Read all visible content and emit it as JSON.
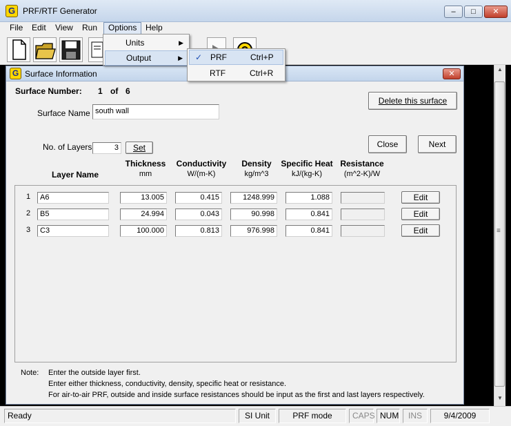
{
  "window": {
    "app_icon": "G",
    "title": "PRF/RTF Generator",
    "minimize_icon": "–",
    "maximize_icon": "□",
    "close_icon": "✕"
  },
  "menu": {
    "items": [
      "File",
      "Edit",
      "View",
      "Run",
      "Options",
      "Help"
    ]
  },
  "options_menu": {
    "units": "Units",
    "output": "Output",
    "arrow": "▶"
  },
  "output_menu": {
    "check": "✓",
    "prf_label": "PRF",
    "prf_shortcut": "Ctrl+P",
    "rtf_label": "RTF",
    "rtf_shortcut": "Ctrl+R"
  },
  "toolbar": {
    "buttons": [
      "new-file-icon",
      "open-folder-icon",
      "save-disk-icon",
      "document-icon",
      "run-icon",
      "play-icon",
      "help-icon"
    ]
  },
  "child": {
    "title": "Surface Information",
    "close_icon": "✕"
  },
  "surface": {
    "number_label": "Surface Number:",
    "number": "1",
    "of": "of",
    "total": "6",
    "name_label": "Surface Name",
    "name_value": "south wall",
    "layers_label": "No. of Layers",
    "layers_value": "3",
    "set_button": "Set",
    "delete_button": "Delete this surface",
    "close_button": "Close",
    "next_button": "Next"
  },
  "columns": {
    "layer_name": "Layer Name",
    "thickness": "Thickness",
    "thickness_unit": "mm",
    "conductivity": "Conductivity",
    "conductivity_unit": "W/(m-K)",
    "density": "Density",
    "density_unit": "kg/m^3",
    "specific_heat": "Specific Heat",
    "specific_heat_unit": "kJ/(kg-K)",
    "resistance": "Resistance",
    "resistance_unit": "(m^2-K)/W"
  },
  "layers": [
    {
      "index": "1",
      "name": "A6",
      "thickness": "13.005",
      "conductivity": "0.415",
      "density": "1248.999",
      "specific_heat": "1.088",
      "resistance": "",
      "edit": "Edit"
    },
    {
      "index": "2",
      "name": "B5",
      "thickness": "24.994",
      "conductivity": "0.043",
      "density": "90.998",
      "specific_heat": "0.841",
      "resistance": "",
      "edit": "Edit"
    },
    {
      "index": "3",
      "name": "C3",
      "thickness": "100.000",
      "conductivity": "0.813",
      "density": "976.998",
      "specific_heat": "0.841",
      "resistance": "",
      "edit": "Edit"
    }
  ],
  "note": {
    "label": "Note:",
    "line1": "Enter the outside layer first.",
    "line2": "Enter either thickness, conductivity, density, specific heat or resistance.",
    "line3": "For air-to-air PRF, outside and inside surface resistances should be input as the first and last layers respectively."
  },
  "scrollbar": {
    "up": "▲",
    "down": "▼",
    "grip": "≡"
  },
  "status": {
    "ready": "Ready",
    "units": "SI Unit",
    "mode": "PRF mode",
    "caps": "CAPS",
    "num": "NUM",
    "ins": "INS",
    "date": "9/4/2009"
  }
}
